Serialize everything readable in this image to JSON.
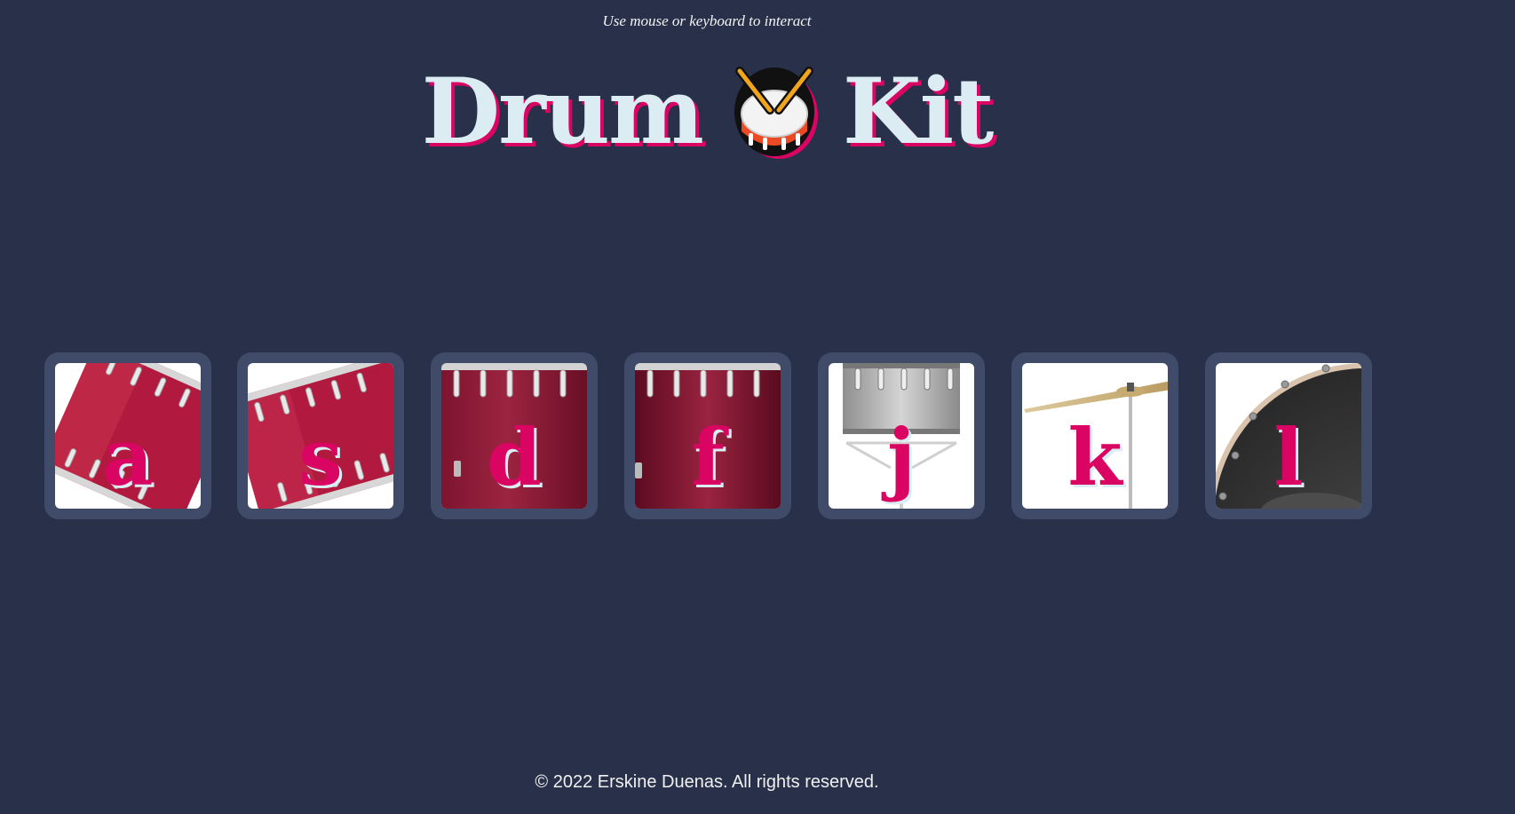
{
  "hint": "Use mouse or keyboard to interact",
  "title": {
    "left_word": "Drum",
    "right_word": "Kit",
    "icon": "drum-icon"
  },
  "pads": [
    {
      "key": "a",
      "image": "tom-drum-icon"
    },
    {
      "key": "s",
      "image": "tom-drum-icon"
    },
    {
      "key": "d",
      "image": "floor-tom-icon"
    },
    {
      "key": "f",
      "image": "floor-tom-icon"
    },
    {
      "key": "j",
      "image": "snare-drum-icon"
    },
    {
      "key": "k",
      "image": "cymbal-icon"
    },
    {
      "key": "l",
      "image": "bass-drum-icon"
    }
  ],
  "footer": "© 2022 Erskine Duenas. All rights reserved.",
  "colors": {
    "background": "#283149",
    "pad_frame": "#404b69",
    "accent": "#da0463",
    "title_text": "#dbedf3"
  }
}
